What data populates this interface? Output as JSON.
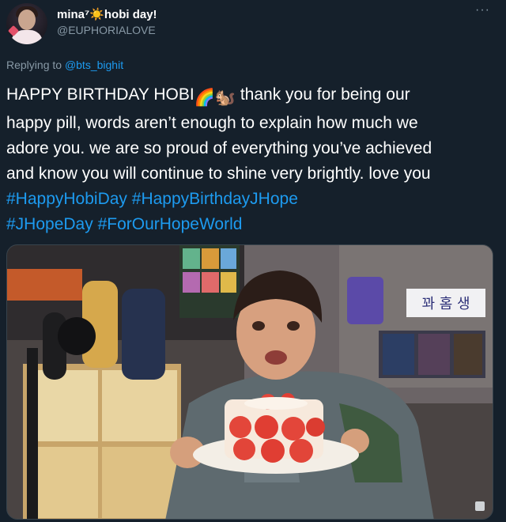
{
  "tweet": {
    "display_name": "mina⁷☀️hobi day!",
    "handle": "@EUPHORIALOVE",
    "more_icon": "more-horizontal-icon",
    "replying_prefix": "Replying to ",
    "replying_to": "@bts_bighit",
    "text_line1_a": "HAPPY BIRTHDAY HOBI",
    "text_line1_b": " thank you for being our",
    "emoji_rainbow": "🌈",
    "emoji_squirrel": "🐿️",
    "text_line2": "happy pill, words aren’t enough to explain how much we",
    "text_line3": "adore you. we are so proud of everything you’ve achieved",
    "text_line4": "and know you will continue to shine very brightly. love you",
    "hashtags": [
      "#HappyHobiDay",
      "#HappyBirthdayJHope",
      "#JHopeDay",
      "#ForOurHopeWorld"
    ],
    "media_sign_text": "꽈 홈 생",
    "colors": {
      "background": "#15202b",
      "link": "#1d9bf0",
      "secondary": "#8899a6"
    }
  }
}
